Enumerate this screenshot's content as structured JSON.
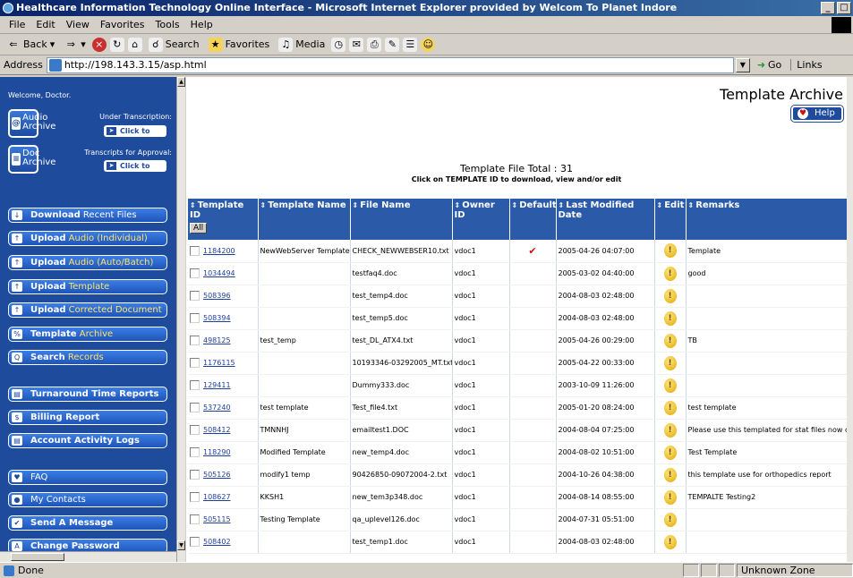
{
  "window": {
    "title": "Healthcare Information Technology Online Interface - Microsoft Internet Explorer provided by Welcom To Planet Indore",
    "buttons": [
      "_",
      "□"
    ]
  },
  "menu": [
    "File",
    "Edit",
    "View",
    "Favorites",
    "Tools",
    "Help"
  ],
  "toolbar": {
    "back": "Back",
    "search": "Search",
    "favorites": "Favorites",
    "media": "Media"
  },
  "address": {
    "label": "Address",
    "url": "http://198.143.3.15/asp.html",
    "go": "Go",
    "links": "Links"
  },
  "sidebar": {
    "welcome": "Welcome, Doctor.",
    "audio_archive": {
      "line1": "Audio",
      "line2": "Archive",
      "note": "Under Transcription:",
      "click": "Click to view"
    },
    "doc_archive": {
      "line1": "Doc",
      "line2": "Archive",
      "note": "Transcripts for Approval:",
      "click": "Click to view"
    },
    "nav": [
      {
        "bold": "Download",
        "rest": " Recent Files",
        "icon": "↓"
      },
      {
        "bold": "Upload",
        "rest": " Audio (Individual)",
        "icon": "↑"
      },
      {
        "bold": "Upload",
        "rest": " Audio (Auto/Batch)",
        "icon": "↑"
      },
      {
        "bold": "Upload",
        "rest": " Template",
        "icon": "↑"
      },
      {
        "bold": "Upload",
        "rest": " Corrected Document",
        "icon": "↑"
      },
      {
        "bold": "Template",
        "rest": " Archive",
        "icon": "%"
      },
      {
        "bold": "Search",
        "rest": " Records",
        "icon": "Q"
      },
      {
        "bold": "Turnaround Time Reports",
        "rest": "",
        "icon": "▤"
      },
      {
        "bold": "Billing Report",
        "rest": "",
        "icon": "$"
      },
      {
        "bold": "Account Activity Logs",
        "rest": "",
        "icon": "▤"
      },
      {
        "bold": "",
        "rest": "FAQ",
        "icon": "♥"
      },
      {
        "bold": "",
        "rest": "My Contacts",
        "icon": "●"
      },
      {
        "bold": "Send A Message",
        "rest": "",
        "icon": "✔"
      },
      {
        "bold": "Change Password",
        "rest": "",
        "icon": "A"
      }
    ]
  },
  "page": {
    "title": "Template Archive",
    "help": "Help",
    "total": "Template File Total : 31",
    "hint": "Click on TEMPLATE ID to download, view and/or edit",
    "all_button": "All"
  },
  "table": {
    "columns": [
      "Template ID",
      "Template Name",
      "File Name",
      "Owner ID",
      "Default",
      "Last Modified Date",
      "Edit",
      "Remarks"
    ],
    "rows": [
      {
        "id": "1184200",
        "name": "NewWebServer Template",
        "file": "CHECK_NEWWEBSER10.txt",
        "owner": "vdoc1",
        "default": "✔",
        "modified": "2005-04-26 04:07:00",
        "remarks": "Template"
      },
      {
        "id": "1034494",
        "name": "",
        "file": "testfaq4.doc",
        "owner": "vdoc1",
        "default": "",
        "modified": "2005-03-02 04:40:00",
        "remarks": "good"
      },
      {
        "id": "508396",
        "name": "",
        "file": "test_temp4.doc",
        "owner": "vdoc1",
        "default": "",
        "modified": "2004-08-03 02:48:00",
        "remarks": ""
      },
      {
        "id": "508394",
        "name": "",
        "file": "test_temp5.doc",
        "owner": "vdoc1",
        "default": "",
        "modified": "2004-08-03 02:48:00",
        "remarks": ""
      },
      {
        "id": "498125",
        "name": "test_temp",
        "file": "test_DL_ATX4.txt",
        "owner": "vdoc1",
        "default": "",
        "modified": "2005-04-26 00:29:00",
        "remarks": "TB"
      },
      {
        "id": "1176115",
        "name": "",
        "file": "10193346-03292005_MT.txt",
        "owner": "vdoc1",
        "default": "",
        "modified": "2005-04-22 00:33:00",
        "remarks": ""
      },
      {
        "id": "129411",
        "name": "",
        "file": "Dummy333.doc",
        "owner": "vdoc1",
        "default": "",
        "modified": "2003-10-09 11:26:00",
        "remarks": ""
      },
      {
        "id": "537240",
        "name": "test template",
        "file": "Test_file4.txt",
        "owner": "vdoc1",
        "default": "",
        "modified": "2005-01-20 08:24:00",
        "remarks": "test template"
      },
      {
        "id": "508412",
        "name": "TMNNHJ",
        "file": "emailtest1.DOC",
        "owner": "vdoc1",
        "default": "",
        "modified": "2004-08-04 07:25:00",
        "remarks": "Please use this templated for stat files now on"
      },
      {
        "id": "118290",
        "name": "Modified Template",
        "file": "new_temp4.doc",
        "owner": "vdoc1",
        "default": "",
        "modified": "2004-08-02 10:51:00",
        "remarks": "Test Template"
      },
      {
        "id": "505126",
        "name": "modify1 temp",
        "file": "90426850-09072004-2.txt",
        "owner": "vdoc1",
        "default": "",
        "modified": "2004-10-26 04:38:00",
        "remarks": "this template use for orthopedics report"
      },
      {
        "id": "108627",
        "name": "KKSH1",
        "file": "new_tem3p348.doc",
        "owner": "vdoc1",
        "default": "",
        "modified": "2004-08-14 08:55:00",
        "remarks": "TEMPALTE Testing2"
      },
      {
        "id": "505115",
        "name": "Testing Template",
        "file": "qa_uplevel126.doc",
        "owner": "vdoc1",
        "default": "",
        "modified": "2004-07-31 05:51:00",
        "remarks": ""
      },
      {
        "id": "508402",
        "name": "",
        "file": "test_temp1.doc",
        "owner": "vdoc1",
        "default": "",
        "modified": "2004-08-03 02:48:00",
        "remarks": ""
      }
    ]
  },
  "status": {
    "text": "Done",
    "zone": "Unknown Zone (Mixed)"
  }
}
